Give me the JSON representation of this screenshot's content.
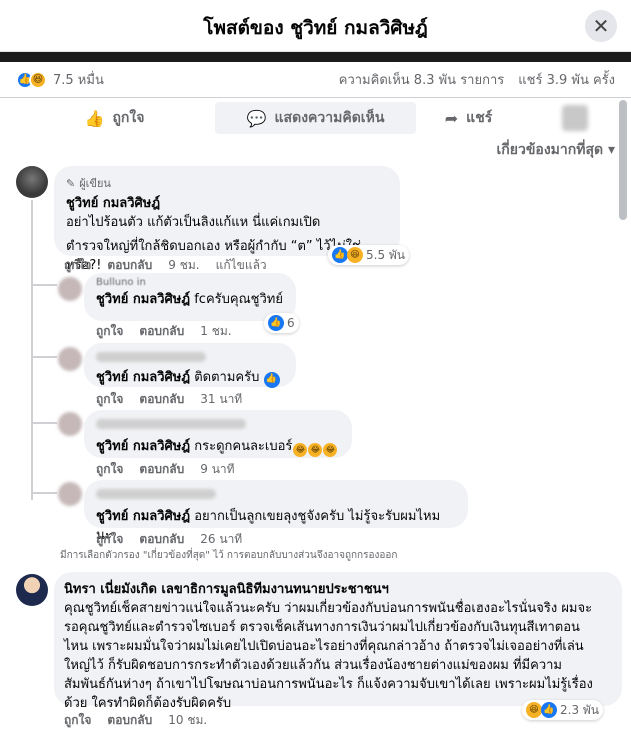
{
  "header": {
    "title": "โพสต์ของ ชูวิทย์ กมลวิศิษฎ์",
    "close_icon": "close-icon"
  },
  "stats": {
    "reaction_count": "7.5 หมื่น",
    "comments": "ความคิดเห็น 8.3 พัน รายการ",
    "shares": "แชร์ 3.9 พัน ครั้ง"
  },
  "actions": {
    "like": "ถูกใจ",
    "comment": "แสดงความคิดเห็น",
    "share": "แชร์"
  },
  "sort_label": "เกี่ยวข้องมากที่สุด",
  "comments": [
    {
      "badge": "ผู้เขียน",
      "name": "ชูวิทย์ กมลวิศิษฎ์",
      "line1": "อย่าไปร้อนตัว แก้ตัวเป็นลิงแก้แห นี่แค่เกมเปิด",
      "line2": "ตำรวจใหญ่ที่ใกล้ชิดบอกเอง หรือผู้กำกับ “ต” ไว้ไม่ใช่หรือ?!",
      "like": "ถูกใจ",
      "reply": "ตอบกลับ",
      "time": "9 ชม.",
      "edited": "แก้ไขแล้ว",
      "reactions": "5.5 พัน"
    }
  ],
  "replies": [
    {
      "name": "ชูวิทย์ กมลวิศิษฎ์",
      "quoted_name": "Bulluno in",
      "text": "fcครับคุณชูวิทย์",
      "like": "ถูกใจ",
      "reply": "ตอบกลับ",
      "time": "1 ชม.",
      "reactions": "6"
    },
    {
      "name": "ชูวิทย์ กมลวิศิษฎ์",
      "text": "ติดตามครับ",
      "like": "ถูกใจ",
      "reply": "ตอบกลับ",
      "time": "31 นาที"
    },
    {
      "name": "ชูวิทย์ กมลวิศิษฎ์",
      "text": "กระดูกคนละเบอร์",
      "like": "ถูกใจ",
      "reply": "ตอบกลับ",
      "time": "9 นาที"
    },
    {
      "name": "ชูวิทย์ กมลวิศิษฎ์",
      "text": "อยากเป็นลูกเขยลุงชูจังครับ ไม่รู้จะรับผมไหมนะ",
      "like": "ถูกใจ",
      "reply": "ตอบกลับ",
      "time": "26 นาที"
    }
  ],
  "filter_note": "มีการเลือกตัวกรอง \"เกี่ยวข้องที่สุด\" ไว้ การตอบกลับบางส่วนจึงอาจถูกกรองออก",
  "comment2": {
    "name": "นิทรา เนี่ยมังเกิด เลขาธิการมูลนิธิทีมงานทนายประชาชนฯ",
    "lines": [
      "คุณชูวิทย์เช็คสายข่าวแน่ใจแล้วนะครับ ว่าผมเกี่ยวข้องกับบ่อนการพนันชื่อเฮงอะไรนั่นจริง ผมจะ",
      "รอคุณชูวิทย์และตำรวจไซเบอร์ ตรวจเช็คเส้นทางการเงินว่าผมไปเกี่ยวข้องกับเงินทุนสีเทาตอน",
      "ไหน เพราะผมมั่นใจว่าผมไม่เคยไปเปิดบ่อนอะไรอย่างที่คุณกล่าวอ้าง ถ้าตรวจไม่เจออย่างที่เล่น",
      "ใหญ่ไว้ ก็รับผิดชอบการกระทำตัวเองด้วยแล้วกัน ส่วนเรื่องน้องชายต่างแม่ของผม ที่มีความ",
      "สัมพันธ์กันห่างๆ ถ้าเขาไปโฆษณาบ่อนการพนันอะไร ก็แจ้งความจับเขาได้เลย เพราะผมไม่รู้เรื่อง",
      "ด้วย ใครทำผิดก็ต้องรับผิดครับ"
    ],
    "like": "ถูกใจ",
    "reply": "ตอบกลับ",
    "time": "10 ชม.",
    "reactions": "2.3 พัน"
  }
}
